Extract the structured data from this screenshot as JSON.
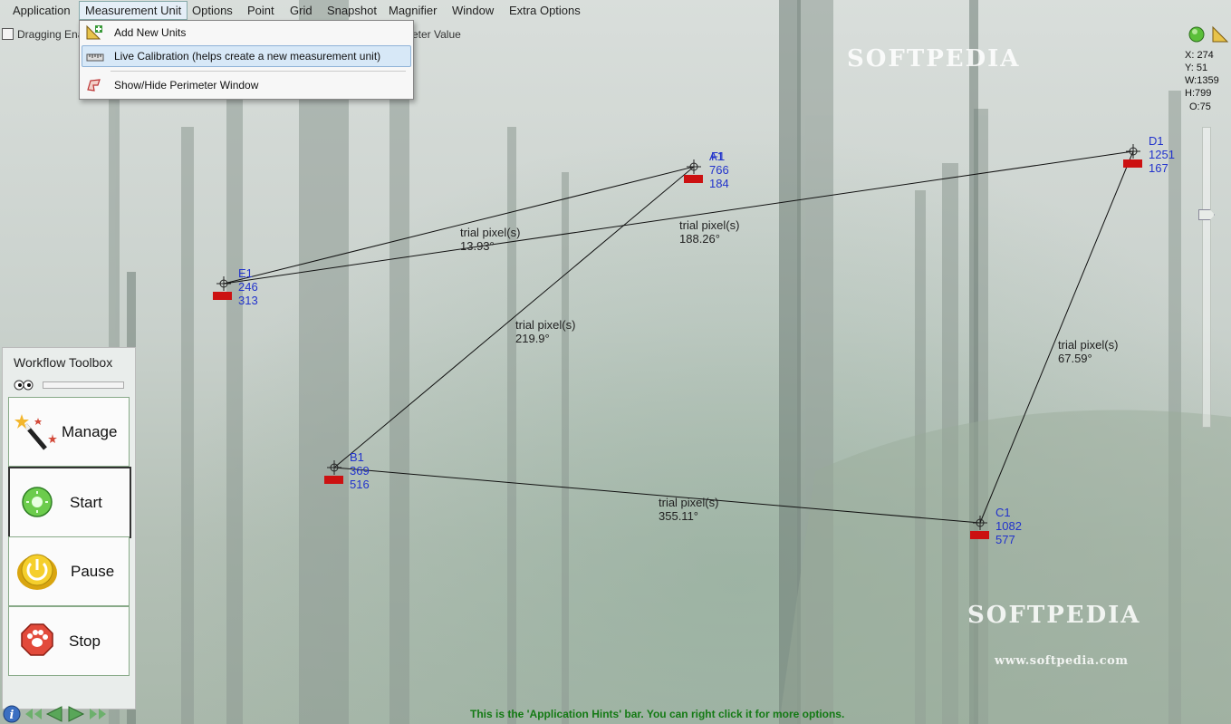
{
  "menubar": {
    "items": [
      "Application",
      "Measurement Unit",
      "Options",
      "Point",
      "Grid",
      "Snapshot",
      "Magnifier",
      "Window",
      "Extra Options"
    ]
  },
  "options_row": {
    "dragging_label": "Dragging Ena",
    "perimeter_label": "eter Value"
  },
  "dropdown": {
    "items": [
      {
        "label": "Add New Units",
        "icon": "ruler-add-icon"
      },
      {
        "label": "Live Calibration (helps create a new measurement unit)",
        "icon": "calibration-ruler-icon"
      },
      {
        "label": "Show/Hide Perimeter Window",
        "icon": "perimeter-window-icon"
      }
    ]
  },
  "watermarks": {
    "top": "SOFTPEDIA",
    "bottom": "SOFTPEDIA",
    "url": "www.softpedia.com"
  },
  "status": {
    "x": "X: 274",
    "y": "Y: 51",
    "w": "W:1359",
    "h": "H:799",
    "o": "O:75"
  },
  "points": [
    {
      "name": "A1",
      "x": "766",
      "y": "184"
    },
    {
      "name": "B1",
      "x": "369",
      "y": "516"
    },
    {
      "name": "C1",
      "x": "1082",
      "y": "577"
    },
    {
      "name": "D1",
      "x": "1251",
      "y": "167"
    },
    {
      "name": "E1",
      "x": "246",
      "y": "313"
    },
    {
      "name": "F1",
      "x": "766",
      "y": "184"
    }
  ],
  "segments": [
    {
      "unit": "trial pixel(s)",
      "angle": "13.93°"
    },
    {
      "unit": "trial pixel(s)",
      "angle": "188.26°"
    },
    {
      "unit": "trial pixel(s)",
      "angle": "219.9°"
    },
    {
      "unit": "trial pixel(s)",
      "angle": "67.59°"
    },
    {
      "unit": "trial pixel(s)",
      "angle": "355.11°"
    }
  ],
  "toolbox": {
    "title": "Workflow Toolbox",
    "buttons": [
      {
        "label": "Manage",
        "icon": "magic-wand-icon"
      },
      {
        "label": "Start",
        "icon": "start-icon"
      },
      {
        "label": "Pause",
        "icon": "pause-icon"
      },
      {
        "label": "Stop",
        "icon": "stop-icon"
      }
    ]
  },
  "hint_bar": {
    "text": "This is the 'Application Hints' bar. You can right click it for more options."
  },
  "colors": {
    "point_label": "#2233cc",
    "marker": "#cc1111",
    "hint": "#147a14"
  }
}
